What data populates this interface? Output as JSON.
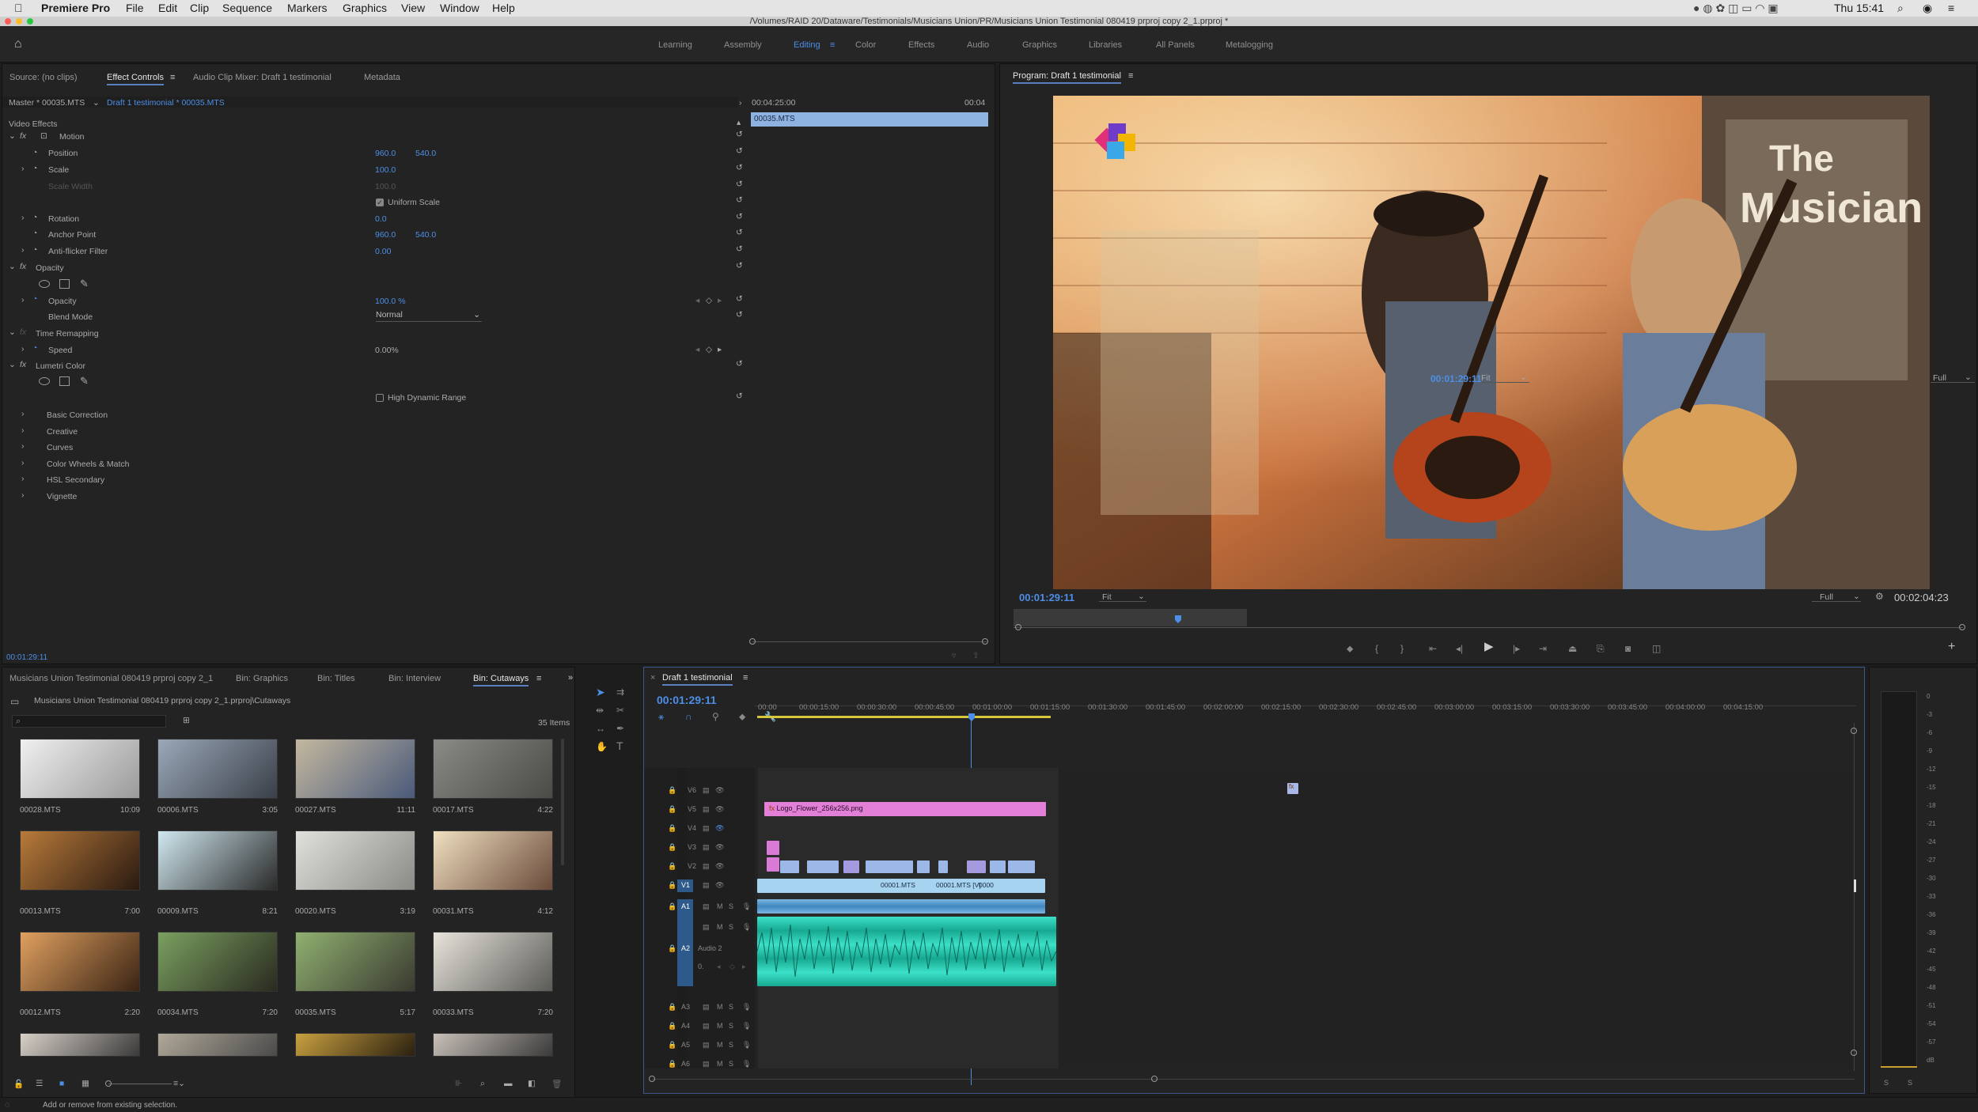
{
  "menubar": {
    "app": "Premiere Pro",
    "items": [
      "File",
      "Edit",
      "Clip",
      "Sequence",
      "Markers",
      "Graphics",
      "View",
      "Window",
      "Help"
    ],
    "clock": "Thu 15:41"
  },
  "titlebar": {
    "path": "/Volumes/RAID 20/Dataware/Testimonials/Musicians Union/PR/Musicians Union Testimonial  080419 prproj copy 2_1.prproj *"
  },
  "workspaces": [
    "Learning",
    "Assembly",
    "Editing",
    "Color",
    "Effects",
    "Audio",
    "Graphics",
    "Libraries",
    "All Panels",
    "Metalogging"
  ],
  "effect_controls": {
    "tabs": [
      "Source: (no clips)",
      "Effect Controls",
      "Audio Clip Mixer: Draft 1 testimonial",
      "Metadata"
    ],
    "master": "Master * 00035.MTS",
    "sequence_clip": "Draft 1 testimonial * 00035.MTS",
    "mini_timecode": "00:04:25:00",
    "mini_end": "00:04",
    "mini_clip": "00035.MTS",
    "section": "Video Effects",
    "motion": "Motion",
    "position": "Position",
    "pos_x": "960.0",
    "pos_y": "540.0",
    "scale": "Scale",
    "scale_val": "100.0",
    "scale_width": "Scale Width",
    "scale_width_val": "100.0",
    "uniform": "Uniform Scale",
    "rotation": "Rotation",
    "rotation_val": "0.0",
    "anchor": "Anchor Point",
    "anchor_x": "960.0",
    "anchor_y": "540.0",
    "antiflicker": "Anti-flicker Filter",
    "antiflicker_val": "0.00",
    "opacity_group": "Opacity",
    "opacity": "Opacity",
    "opacity_val": "100.0 %",
    "blend": "Blend Mode",
    "blend_val": "Normal",
    "time_remap": "Time Remapping",
    "speed": "Speed",
    "speed_val": "0.00%",
    "lumetri": "Lumetri Color",
    "hdr": "High Dynamic Range",
    "lumetri_items": [
      "Basic Correction",
      "Creative",
      "Curves",
      "Color Wheels & Match",
      "HSL Secondary",
      "Vignette"
    ],
    "bottom_tc": "00:01:29:11"
  },
  "program": {
    "title": "Program: Draft 1 testimonial",
    "timecode": "00:01:29:11",
    "fit": "Fit",
    "full": "Full",
    "duration": "00:02:04:23"
  },
  "project": {
    "tabs": [
      "Musicians Union Testimonial  080419 prproj copy 2_1",
      "Bin: Graphics",
      "Bin: Titles",
      "Bin: Interview",
      "Bin: Cutaways"
    ],
    "path": "Musicians Union Testimonial  080419 prproj copy 2_1.prproj\\Cutaways",
    "count": "35 Items",
    "clips": [
      {
        "name": "00028.MTS",
        "dur": "10:09"
      },
      {
        "name": "00006.MTS",
        "dur": "3:05"
      },
      {
        "name": "00027.MTS",
        "dur": "11:11"
      },
      {
        "name": "00017.MTS",
        "dur": "4:22"
      },
      {
        "name": "00013.MTS",
        "dur": "7:00"
      },
      {
        "name": "00009.MTS",
        "dur": "8:21"
      },
      {
        "name": "00020.MTS",
        "dur": "3:19"
      },
      {
        "name": "00031.MTS",
        "dur": "4:12"
      },
      {
        "name": "00012.MTS",
        "dur": "2:20"
      },
      {
        "name": "00034.MTS",
        "dur": "7:20"
      },
      {
        "name": "00035.MTS",
        "dur": "5:17"
      },
      {
        "name": "00033.MTS",
        "dur": "7:20"
      }
    ]
  },
  "timeline": {
    "title": "Draft 1 testimonial",
    "timecode": "00:01:29:11",
    "ruler": [
      "00:00",
      "00:00:15:00",
      "00:00:30:00",
      "00:00:45:00",
      "00:01:00:00",
      "00:01:15:00",
      "00:01:30:00",
      "00:01:45:00",
      "00:02:00:00",
      "00:02:15:00",
      "00:02:30:00",
      "00:02:45:00",
      "00:03:00:00",
      "00:03:15:00",
      "00:03:30:00",
      "00:03:45:00",
      "00:04:00:00",
      "00:04:15:00"
    ],
    "video_tracks": [
      "V6",
      "V5",
      "V4",
      "V3",
      "V2",
      "V1"
    ],
    "audio_tracks": [
      "A1",
      "A2",
      "A3",
      "A4",
      "A5",
      "A6"
    ],
    "logo_clip": "Logo_Flower_256x256.png",
    "v1_labels": [
      "00001.MTS",
      "00001.MTS [V]",
      "0000"
    ],
    "audio2_label": "Audio 2",
    "audio2_vol": "0.",
    "meter_scale": [
      "0",
      "-3",
      "-6",
      "-9",
      "-12",
      "-15",
      "-18",
      "-21",
      "-24",
      "-27",
      "-30",
      "-33",
      "-36",
      "-39",
      "-42",
      "-45",
      "-48",
      "-51",
      "-54",
      "-57",
      "dB"
    ]
  },
  "status": "Add or remove from existing selection."
}
